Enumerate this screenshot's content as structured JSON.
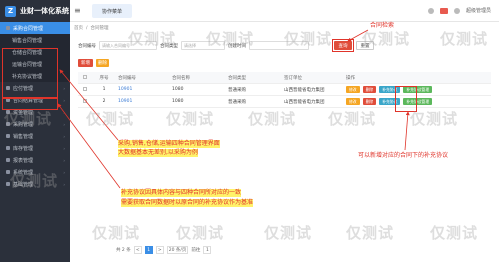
{
  "app": {
    "title": "业财一体化系统",
    "logo_letter": "Z"
  },
  "header": {
    "tab": "协作菜单",
    "user": "超级管理员"
  },
  "breadcrumb": [
    "首页",
    "合同管理"
  ],
  "sidebar": {
    "items": [
      {
        "label": "采购合同管理",
        "active": true,
        "sub": false
      },
      {
        "label": "销售合同管理",
        "active": false,
        "sub": true
      },
      {
        "label": "仓储合同管理",
        "active": false,
        "sub": true
      },
      {
        "label": "运输合同管理",
        "active": false,
        "sub": true
      },
      {
        "label": "补充协议管理",
        "active": false,
        "sub": true
      },
      {
        "label": "应付管理",
        "active": false,
        "sub": false
      },
      {
        "label": "合同结算管理",
        "active": false,
        "sub": false
      },
      {
        "label": "资金管理",
        "active": false,
        "sub": false
      },
      {
        "label": "采购管理",
        "active": false,
        "sub": false
      },
      {
        "label": "销售管理",
        "active": false,
        "sub": false
      },
      {
        "label": "库存管理",
        "active": false,
        "sub": false
      },
      {
        "label": "报表管理",
        "active": false,
        "sub": false
      },
      {
        "label": "系统管理",
        "active": false,
        "sub": false
      },
      {
        "label": "基础管理",
        "active": false,
        "sub": false
      }
    ]
  },
  "filters": {
    "contract_no_label": "合同编号",
    "contract_no_placeholder": "请输入合同编号",
    "type_label": "合同类型",
    "type_placeholder": "请选择",
    "date_label": "创建时间",
    "search": "查询",
    "reset": "重置"
  },
  "toolbar": {
    "add": "新增",
    "delete": "删除"
  },
  "table": {
    "headers": [
      "",
      "序号",
      "合同编号",
      "合同名称",
      "合同类型",
      "签订单位",
      "操作"
    ],
    "rows": [
      {
        "index": "1",
        "no": "10901",
        "name": "1080",
        "type": "普通采购",
        "party": "山西晋能省电力集团",
        "ops": [
          "修改",
          "删除",
          "补充协议",
          "补充协议管理"
        ]
      },
      {
        "index": "2",
        "no": "10901",
        "name": "1080",
        "type": "普通采购",
        "party": "山西晋能省电力集团",
        "ops": [
          "修改",
          "删除",
          "补充协议",
          "补充协议管理"
        ]
      }
    ]
  },
  "pager": {
    "total": "共 2 条",
    "prev": "<",
    "page": "1",
    "next": ">",
    "size": "20 条/页",
    "goto": "前往",
    "goto_page": "1"
  },
  "annotations": {
    "top": "合同检索",
    "right": "可以新增对应的合同下的补充协议",
    "middle_1": "采购,销售,仓储,运输四种合同管理界面",
    "middle_2": "大数据基本无差别,以采购为例",
    "bottom_1": "补充协议因具体内容与四种合同所对应的一致",
    "bottom_2": "需要获取合同数据时以原合同的补充协议作为基准"
  },
  "watermark": "仅测试"
}
